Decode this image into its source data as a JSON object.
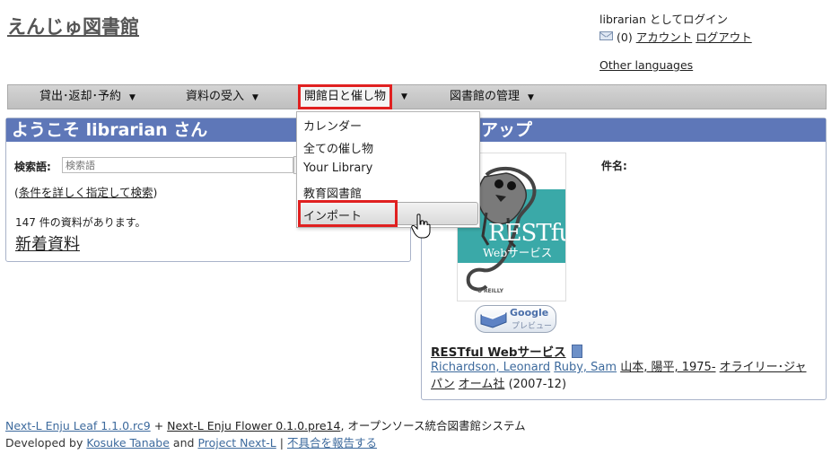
{
  "header": {
    "site_title": "えんじゅ図書館",
    "login_text": "librarian としてログイン",
    "mail_count": "(0)",
    "account_link": "アカウント",
    "logout_link": "ログアウト",
    "other_languages": "Other languages"
  },
  "nav": {
    "items": [
      {
        "label": "貸出･返却･予約"
      },
      {
        "label": "資料の受入"
      },
      {
        "label": "開館日と催し物"
      },
      {
        "label": "図書館の管理"
      }
    ],
    "caret": "▼"
  },
  "dropdown": {
    "items": [
      {
        "label": "カレンダー"
      },
      {
        "label": "全ての催し物"
      },
      {
        "label": "Your Library"
      },
      {
        "label": "教育図書館"
      },
      {
        "label": "インポート"
      }
    ]
  },
  "welcome_panel": {
    "title": "ようこそ librarian さん",
    "search_label": "検索語:",
    "search_placeholder": "検索語",
    "advanced_open": "(",
    "advanced_link": "条件を詳しく指定して検索",
    "advanced_close": ")",
    "count_text": "147 件の資料があります。",
    "new_items_link": "新着資料"
  },
  "pickup_panel": {
    "title": "アップ",
    "subject_label": "件名:",
    "google_preview": "Google",
    "google_preview_sub": "プレビュー",
    "book_title": "RESTful Webサービス",
    "cover_title": "RESTful",
    "cover_subtitle": "Webサービス",
    "cover_publisher": "O'REILLY",
    "authors": [
      {
        "name": "Richardson, Leonard"
      },
      {
        "name": "Ruby, Sam"
      },
      {
        "name": "山本, 陽平, 1975-"
      },
      {
        "name": "オライリー･ジャパン"
      },
      {
        "name": "オーム社"
      }
    ],
    "date": "(2007-12)"
  },
  "footer": {
    "leaf": "Next-L Enju Leaf 1.1.0.rc9",
    "plus": "+",
    "flower": "Next-L Enju Flower 0.1.0.pre14",
    "suffix": ", オープンソース統合図書館システム",
    "developed_by": "Developed by",
    "author": "Kosuke Tanabe",
    "and": "and",
    "project": "Project Next-L",
    "sep": "|",
    "report": "不具合を報告する"
  },
  "colors": {
    "panel_header": "#5e77b8",
    "highlight": "#e02020",
    "link": "#3d6a9d"
  }
}
